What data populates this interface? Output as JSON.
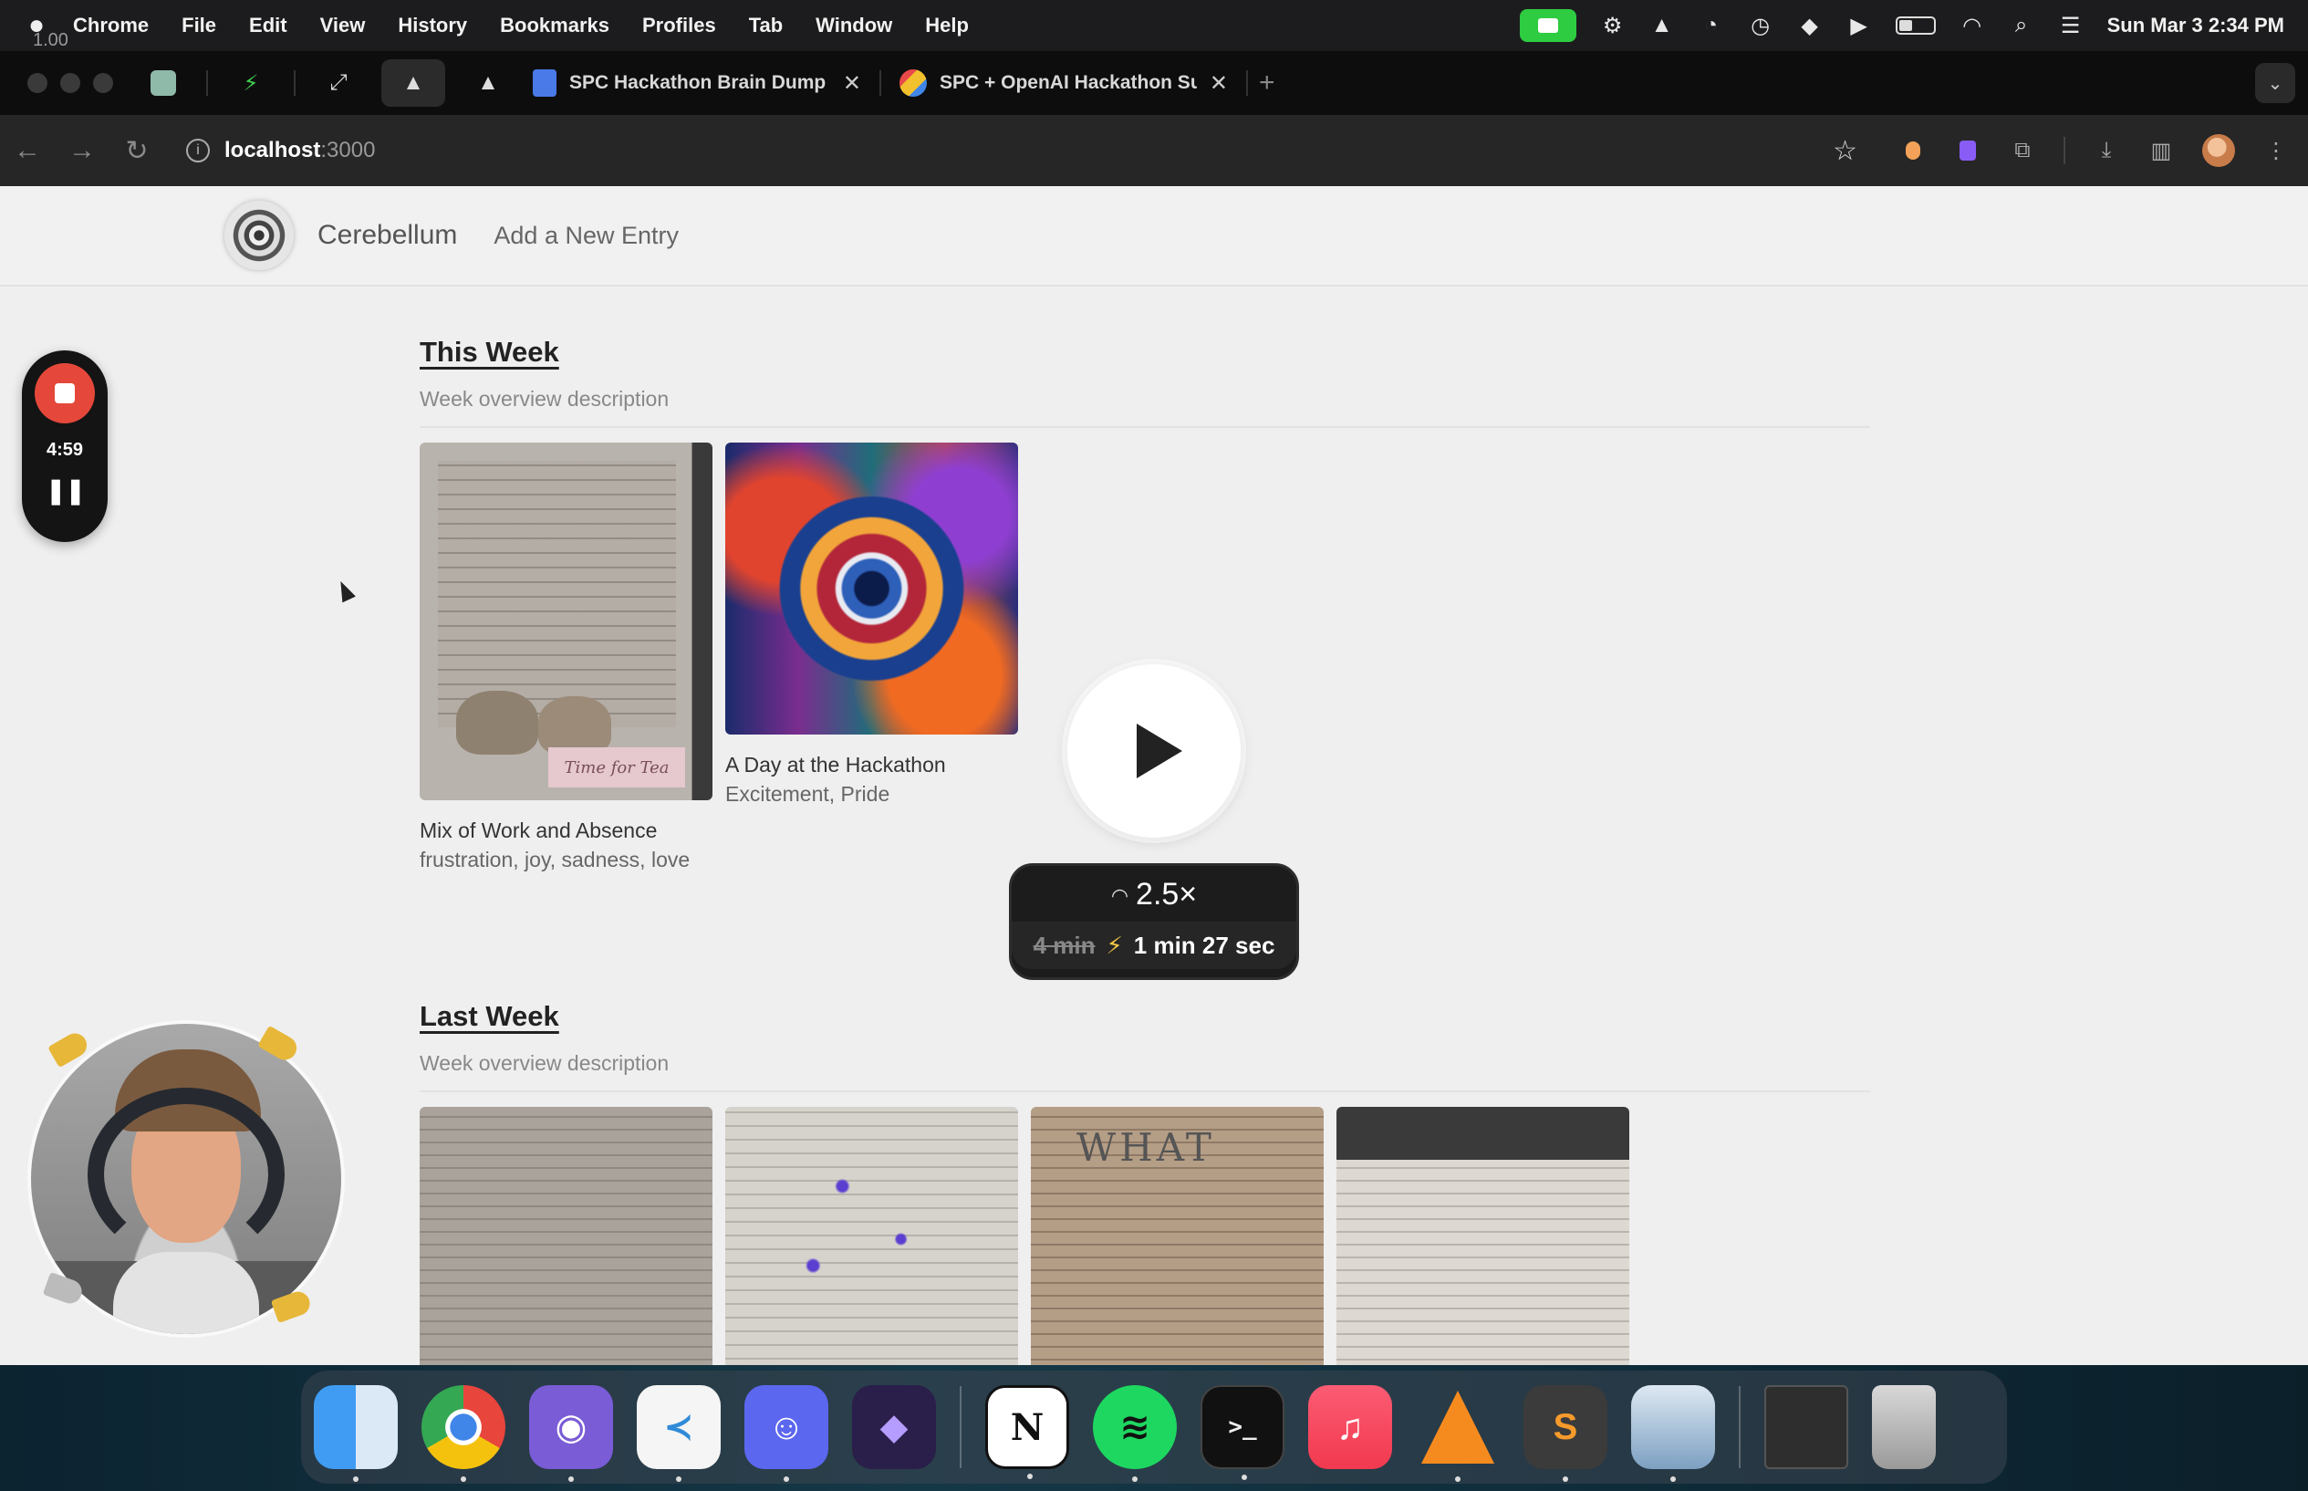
{
  "menubar": {
    "zoom": "1.00",
    "app": "Chrome",
    "items": [
      "File",
      "Edit",
      "View",
      "History",
      "Bookmarks",
      "Profiles",
      "Tab",
      "Window",
      "Help"
    ],
    "clock": "Sun Mar 3  2:34 PM"
  },
  "browser": {
    "tabs": [
      {
        "title": "SPC Hackathon Brain Dump -",
        "icon": "google-doc-icon"
      },
      {
        "title": "SPC + OpenAI Hackathon Su",
        "icon": "spc-icon"
      }
    ],
    "new_tab": "+",
    "url_host": "localhost",
    "url_port": ":3000"
  },
  "site": {
    "brand": "Cerebellum",
    "nav_link": "Add a New Entry"
  },
  "weeks": [
    {
      "title": "This Week",
      "description": "Week overview description",
      "entries": [
        {
          "title": "Mix of Work and Absence",
          "emotions": "frustration, joy, sadness, love",
          "image": "journal-page-illustrated",
          "stamp": "Time for Tea"
        },
        {
          "title": "A Day at the Hackathon",
          "emotions": "Excitement, Pride",
          "image": "abstract-swirl-art"
        }
      ]
    },
    {
      "title": "Last Week",
      "description": "Week overview description",
      "entries": [
        {
          "image": "journal-page-sketch"
        },
        {
          "image": "journal-page-tree"
        },
        {
          "image": "journal-page-what",
          "heading": "WHAT"
        },
        {
          "image": "journal-page-handwritten"
        }
      ]
    }
  ],
  "recorder": {
    "time": "4:59"
  },
  "playback": {
    "speed": "2.5×",
    "original_duration": "4 min",
    "new_duration": "1 min 27 sec"
  },
  "dock": {
    "apps": [
      "Finder",
      "Google Chrome",
      "GitHub Desktop",
      "Visual Studio Code",
      "Discord",
      "Obsidian",
      "Notion",
      "Spotify",
      "Terminal",
      "Music",
      "VLC",
      "Sublime Text",
      "Preview",
      "Screenshot",
      "Trash"
    ]
  },
  "colors": {
    "record_red": "#e5483a",
    "facetime_green": "#2ecc40",
    "page_bg": "#efefef"
  }
}
